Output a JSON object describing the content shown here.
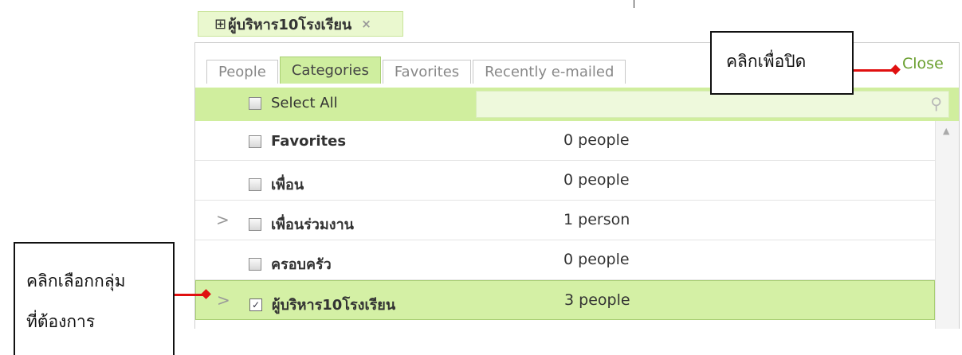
{
  "top_chip": {
    "icon": "plus-square-icon",
    "label": "ผู้บริหาร10โรงเรียน",
    "close_glyph": "×"
  },
  "tabs": [
    {
      "label": "People",
      "active": false
    },
    {
      "label": "Categories",
      "active": true
    },
    {
      "label": "Favorites",
      "active": false
    },
    {
      "label": "Recently e-mailed",
      "active": false
    }
  ],
  "close_label": "Close",
  "select_all_label": "Select All",
  "search": {
    "value": "",
    "placeholder": ""
  },
  "rows": [
    {
      "name": "Favorites",
      "count": "0 people",
      "expandable": false,
      "checked": false
    },
    {
      "name": "เพื่อน",
      "count": "0 people",
      "expandable": false,
      "checked": false
    },
    {
      "name": "เพื่อนร่วมงาน",
      "count": "1 person",
      "expandable": true,
      "checked": false
    },
    {
      "name": "ครอบครัว",
      "count": "0 people",
      "expandable": false,
      "checked": false
    },
    {
      "name": "ผู้บริหาร10โรงเรียน",
      "count": "3 people",
      "expandable": true,
      "checked": true
    }
  ],
  "annotations": {
    "close_callout": "คลิกเพื่อปิด",
    "group_callout_line1": "คลิกเลือกกลุ่ม",
    "group_callout_line2": "ที่ต้องการ"
  },
  "colors": {
    "accent_green": "#d0ee9e",
    "close_green": "#6a9f2f",
    "arrow_red": "#e01010"
  }
}
